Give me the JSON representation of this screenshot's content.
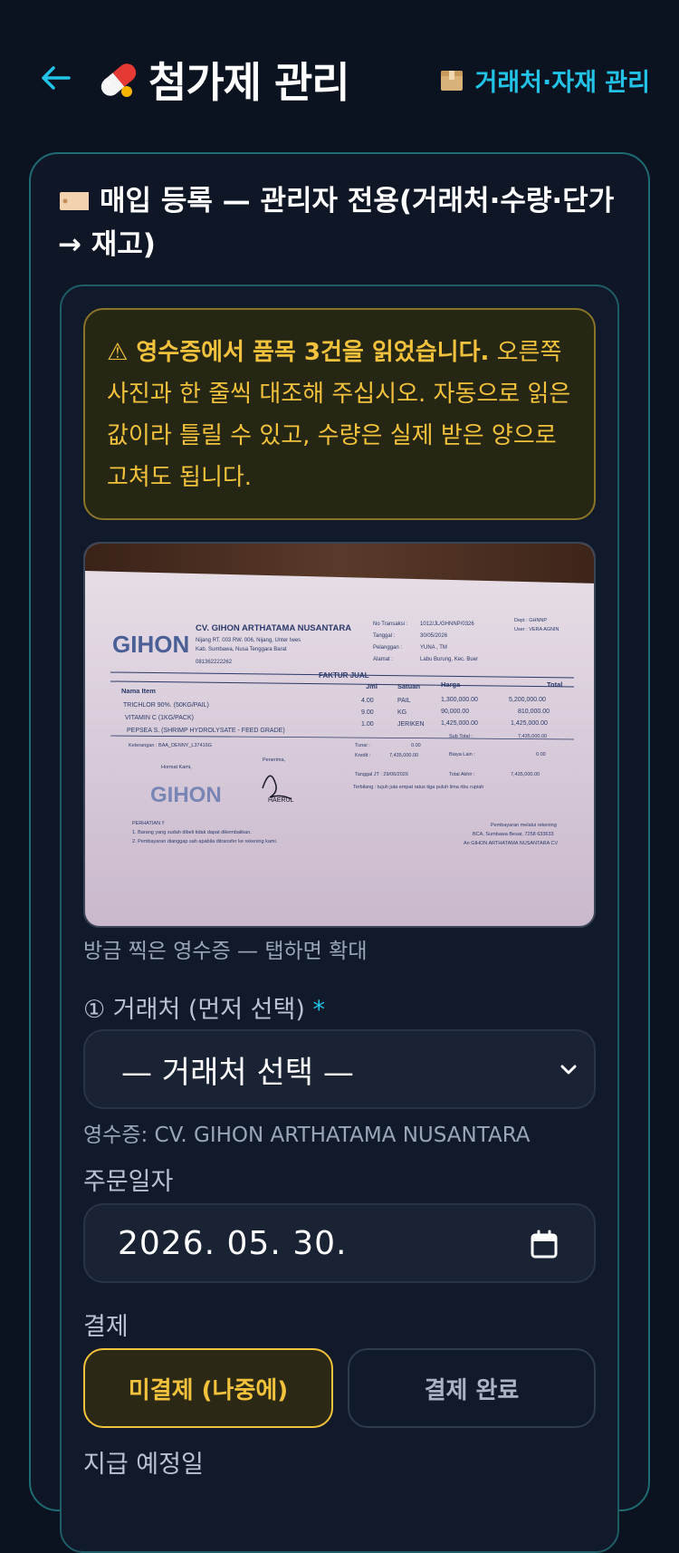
{
  "header": {
    "back_icon": "arrow-left-icon",
    "title_icon": "pill-icon",
    "title": "첨가제 관리",
    "vendor_link_icon": "package-icon",
    "vendor_link": "거래처·자재 관리",
    "accent": "#22c3e6"
  },
  "card": {
    "icon": "tag-icon",
    "heading": "매입 등록 — 관리자 전용(거래처·수량·단가 → 재고)"
  },
  "notice": {
    "icon": "warning-icon",
    "bold": "⚠ 영수증에서 품목 3건을 읽었습니다.",
    "text": " 오른쪽 사진과 한 줄씩 대조해 주십시오. 자동으로 읽은 값이라 틀릴 수 있고, 수량은 실제 받은 양으로 고쳐도 됩니다.",
    "color": "#f2c23c"
  },
  "receipt": {
    "caption": "방금 찍은 영수증 — 탭하면 확대",
    "company": "CV. GIHON ARTHATAMA NUSANTARA",
    "logo": "GIHON",
    "address1": "Nijang RT. 003 RW. 006, Nijang, Unter Iwes",
    "address2": "Kab. Sumbawa, Nusa Tenggara Barat",
    "phone": "081362222262",
    "meta": [
      {
        "label": "No Transaksi :",
        "value": "1012/JL/GHNNP/0326"
      },
      {
        "label": "Tanggal :",
        "value": "30/05/2026"
      },
      {
        "label": "Pelanggan :",
        "value": "YUNA , TM"
      },
      {
        "label": "Alamat :",
        "value": "Labu Burung, Kec. Buer"
      }
    ],
    "dept": "Dept : GHNNP",
    "user": "User : VERA AGNIN",
    "doc_title": "FAKTUR JUAL",
    "columns": [
      "Nama Item",
      "Jml",
      "Satuan",
      "Harga",
      "Total"
    ],
    "items": [
      {
        "name": "TRICHLOR 90%. (50KG/PAIL)",
        "qty": "4.00",
        "unit": "PAIL",
        "price": "1,300,000.00",
        "total": "5,200,000.00"
      },
      {
        "name": "VITAMIN C (1KG/PACK)",
        "qty": "9.00",
        "unit": "KG",
        "price": "90,000.00",
        "total": "810,000.00"
      },
      {
        "name": "PEPSEA S. (SHRIMP HYDROLYSATE - FEED GRADE)",
        "qty": "1.00",
        "unit": "JERIKEN",
        "price": "1,425,000.00",
        "total": "1,425,000.00"
      }
    ],
    "note": "Keterangan : BAA_DENNY_L37416G",
    "summary": [
      {
        "label": "Sub Total :",
        "value": "7,435,000.00"
      },
      {
        "label": "Tunai :",
        "value": "0.00"
      },
      {
        "label": "Kredit :",
        "value": "7,435,000.00"
      },
      {
        "label": "Biaya Lain :",
        "value": "0.00"
      },
      {
        "label": "Total Akhir :",
        "value": "7,435,000.00"
      }
    ],
    "due": "Tanggal JT : 29/06/2026",
    "terbilang": "Terbilang : tujuh juta empat ratus tiga puluh lima ribu rupiah",
    "hormat": "Hormat Kami,",
    "penerima": "Penerima,",
    "signature_name": "HAERUL",
    "perhatian": "PERHATIAN !!",
    "rule1": "1. Barang yang sudah dibeli tidak dapat dikembalikan.",
    "rule2": "2. Pembayaran dianggap sah apabila ditransfer ke rekening kami.",
    "bank1": "Pembayaran melalui rekening",
    "bank2": "BCA, Sumbawa Besar, 7258 633633",
    "bank3": "An GIHON ARTHATAMA NUSANTARA CV"
  },
  "vendor_field": {
    "label": "① 거래처 (먼저 선택)",
    "required": "*",
    "selected": "— 거래처 선택 —",
    "chevron_icon": "chevron-down-icon",
    "hint": "영수증: CV. GIHON ARTHATAMA NUSANTARA"
  },
  "order_date": {
    "label": "주문일자",
    "value": "2026. 05. 30.",
    "calendar_icon": "calendar-icon"
  },
  "payment": {
    "label": "결제",
    "options": [
      "미결제 (나중에)",
      "결제 완료"
    ],
    "selected": "미결제 (나중에)"
  },
  "due_date": {
    "label": "지급 예정일"
  }
}
